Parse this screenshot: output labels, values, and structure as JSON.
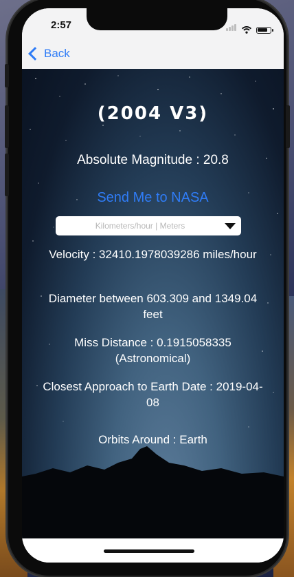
{
  "status_bar": {
    "time": "2:57"
  },
  "nav": {
    "back_label": "Back"
  },
  "asteroid": {
    "name": "(2004 V3)",
    "absolute_magnitude": "Absolute Magnitude : 20.8",
    "nasa_link": "Send Me to NASA",
    "unit_select": {
      "selected": "Kilometers/hour | Meters"
    },
    "velocity": "Velocity : 32410.1978039286 miles/hour",
    "diameter": "Diameter between 603.309 and 1349.04 feet",
    "miss_distance": "Miss Distance : 0.1915058335 (Astronomical)",
    "closest_approach": "Closest Approach to Earth Date : 2019-04-08",
    "orbits": "Orbits Around : Earth"
  },
  "colors": {
    "accent": "#2f7cf6",
    "bar_background": "#f3f3f4",
    "text_on_dark": "#ffffff"
  }
}
